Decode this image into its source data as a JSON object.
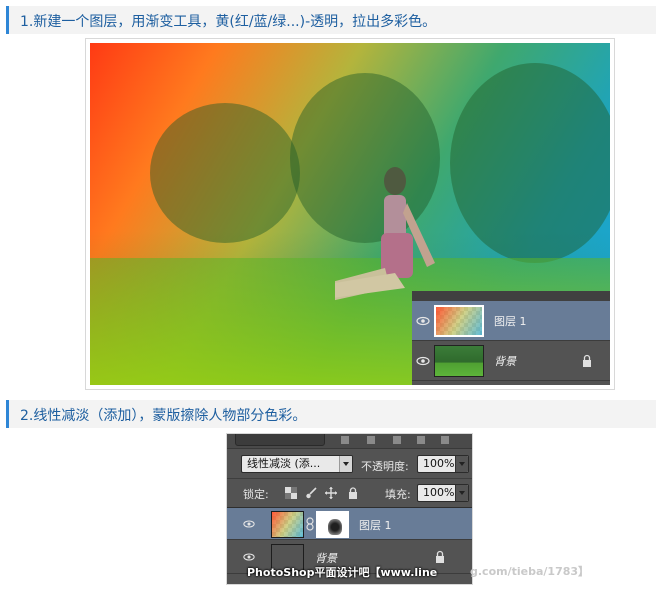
{
  "step1": {
    "text": "1.新建一个图层，用渐变工具，黄(红/蓝/绿...)-透明，拉出多彩色。"
  },
  "figure1": {
    "layers": [
      {
        "name": "图层 1",
        "selected": true,
        "thumb": "gradient-transparency"
      },
      {
        "name": "背景",
        "selected": false,
        "thumb": "photo",
        "locked": true
      }
    ],
    "gradient_colors": [
      "#ff3a14",
      "#b4b43c",
      "#3fa86e",
      "#17a6df"
    ]
  },
  "step2": {
    "text": "2.线性减淡（添加），蒙版擦除人物部分色彩。"
  },
  "figure2": {
    "blend_mode": "线性减淡 (添...",
    "opacity_label": "不透明度:",
    "opacity_value": "100%",
    "lock_label": "锁定:",
    "fill_label": "填充:",
    "fill_value": "100%",
    "layers": [
      {
        "name": "图层 1",
        "selected": true,
        "has_mask": true
      },
      {
        "name": "背景",
        "selected": false,
        "locked": true
      }
    ],
    "watermark": "PhotoShop平面设计吧【www.line",
    "watermark_tail": "g.com/tieba/1783】"
  },
  "colors": {
    "accent": "#2e86d6",
    "heading_text": "#1e5fa0",
    "panel_bg": "#535353",
    "selected_row": "#687c97"
  }
}
